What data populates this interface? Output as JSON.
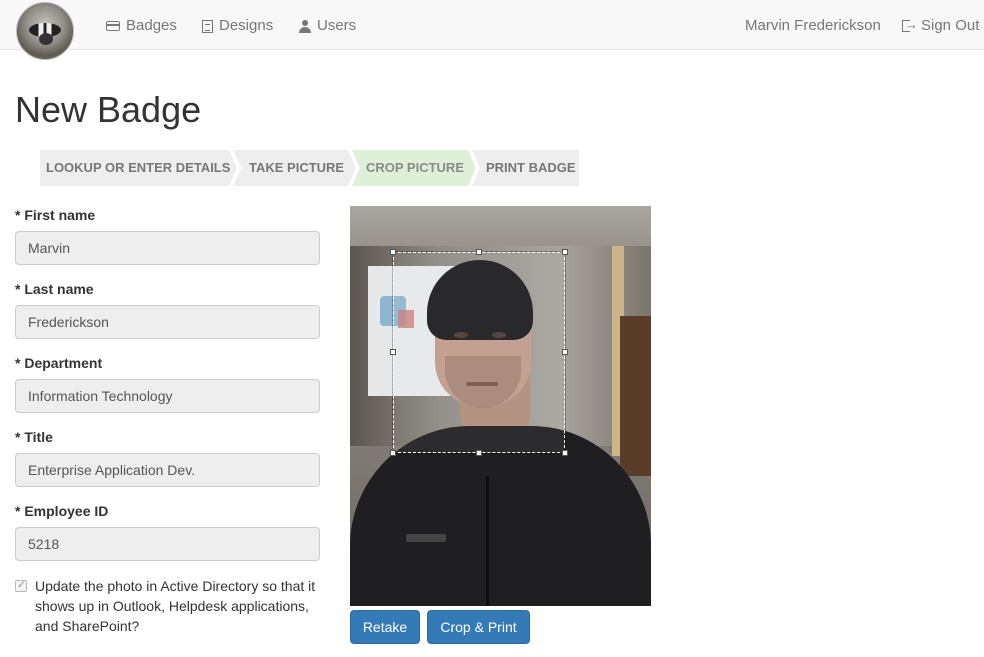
{
  "navbar": {
    "logo_name": "badger-logo",
    "items": [
      {
        "label": "Badges",
        "icon": "badge-card-icon"
      },
      {
        "label": "Designs",
        "icon": "document-icon"
      },
      {
        "label": "Users",
        "icon": "user-icon"
      }
    ],
    "user_name": "Marvin Frederickson",
    "sign_out_label": "Sign Out",
    "sign_out_icon": "sign-out-icon"
  },
  "page": {
    "title": "New Badge"
  },
  "steps": [
    {
      "label": "LOOKUP OR ENTER DETAILS",
      "active": false
    },
    {
      "label": "TAKE PICTURE",
      "active": false
    },
    {
      "label": "CROP PICTURE",
      "active": true
    },
    {
      "label": "PRINT BADGE",
      "active": false
    }
  ],
  "form": {
    "first_name": {
      "label": "* First name",
      "value": "Marvin"
    },
    "last_name": {
      "label": "* Last name",
      "value": "Frederickson"
    },
    "department": {
      "label": "* Department",
      "value": "Information Technology"
    },
    "title": {
      "label": "* Title",
      "value": "Enterprise Application Dev."
    },
    "employee_id": {
      "label": "* Employee ID",
      "value": "5218"
    },
    "update_ad": {
      "checked": true,
      "label": "Update the photo in Active Directory so that it shows up in Outlook, Helpdesk applications, and SharePoint?"
    }
  },
  "photo": {
    "alt": "webcam capture"
  },
  "buttons": {
    "retake": "Retake",
    "crop_print": "Crop & Print"
  },
  "colors": {
    "primary": "#337ab7",
    "active_step": "#dff0d8",
    "step": "#eeeeee",
    "navbar": "#f8f8f8"
  }
}
